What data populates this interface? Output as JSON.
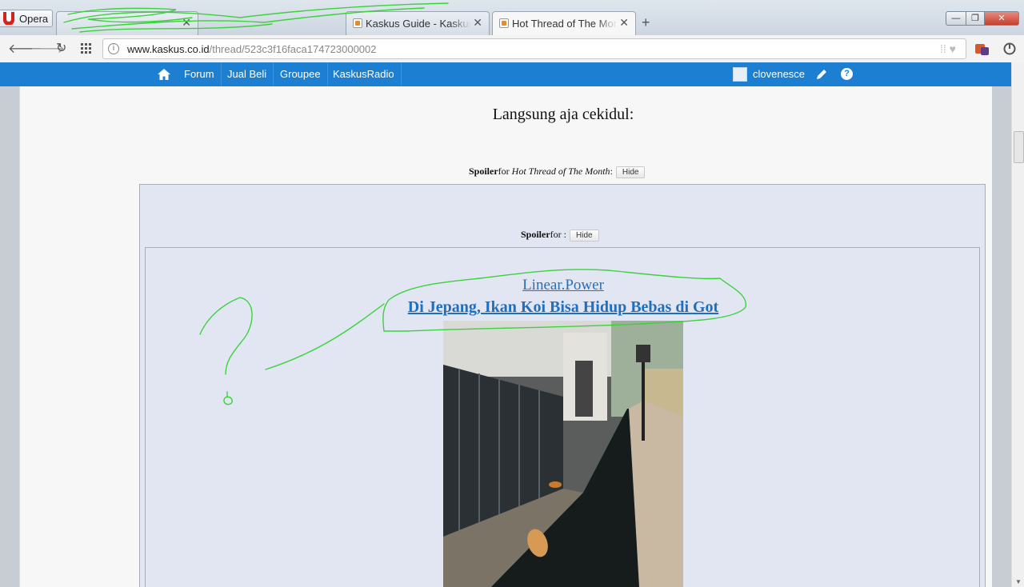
{
  "browser": {
    "menu_label": "Opera",
    "tabs": [
      {
        "title": "",
        "active": false
      },
      {
        "title": "Kaskus Guide - Kaskus",
        "active": false
      },
      {
        "title": "Hot Thread of The Month",
        "active": true
      }
    ],
    "new_tab_glyph": "+",
    "window_controls": {
      "minimize": "—",
      "maximize": "❐",
      "close": "✕"
    }
  },
  "address_bar": {
    "url_host": "www.kaskus.co.id",
    "url_path": "/thread/523c3f16faca174723000002"
  },
  "site_nav": {
    "items": [
      "Forum",
      "Jual Beli",
      "Groupee",
      "KaskusRadio"
    ],
    "username": "clovenesce",
    "help_glyph": "?"
  },
  "content": {
    "heading": "Langsung aja cekidul:",
    "spoiler1": {
      "label": "Spoiler",
      "for_text": "for ",
      "subject": "Hot Thread of The Month",
      "colon": ":",
      "button": "Hide"
    },
    "spoiler2": {
      "label": "Spoiler",
      "for_text": "for ",
      "subject": "",
      "colon": ":",
      "button": "Hide"
    },
    "author_link": "Linear.Power",
    "thread_link": "Di Jepang, Ikan Koi Bisa Hidup Bebas di Got"
  },
  "colors": {
    "nav_blue": "#1d7fd1",
    "link_blue": "#1f6fbf",
    "spoiler_bg": "#e2e6f3",
    "annotation_green": "#3cd23c"
  }
}
